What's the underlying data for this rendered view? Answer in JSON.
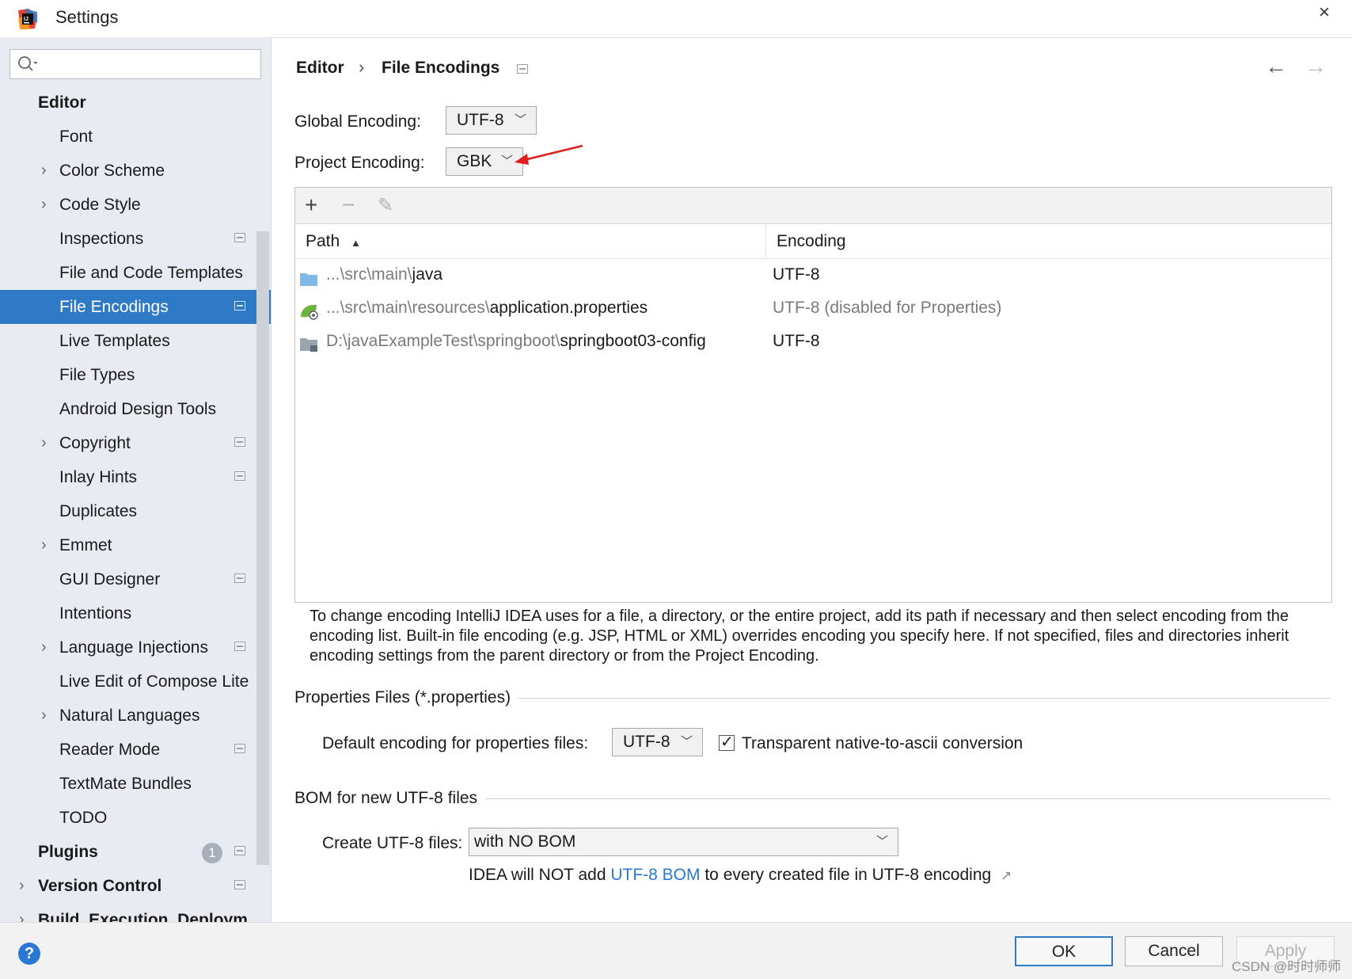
{
  "window": {
    "title": "Settings",
    "close_glyph": "×"
  },
  "search": {
    "placeholder": ""
  },
  "sidebar": {
    "items": [
      {
        "label": "Editor",
        "level": "top",
        "chevron": false,
        "proj": false
      },
      {
        "label": "Font",
        "level": "sub",
        "chevron": false,
        "proj": false
      },
      {
        "label": "Color Scheme",
        "level": "sub",
        "chevron": true,
        "proj": false
      },
      {
        "label": "Code Style",
        "level": "sub",
        "chevron": true,
        "proj": false
      },
      {
        "label": "Inspections",
        "level": "sub",
        "chevron": false,
        "proj": true
      },
      {
        "label": "File and Code Templates",
        "level": "sub",
        "chevron": false,
        "proj": false
      },
      {
        "label": "File Encodings",
        "level": "sub",
        "chevron": false,
        "proj": true,
        "selected": true
      },
      {
        "label": "Live Templates",
        "level": "sub",
        "chevron": false,
        "proj": false
      },
      {
        "label": "File Types",
        "level": "sub",
        "chevron": false,
        "proj": false
      },
      {
        "label": "Android Design Tools",
        "level": "sub",
        "chevron": false,
        "proj": false
      },
      {
        "label": "Copyright",
        "level": "sub",
        "chevron": true,
        "proj": true
      },
      {
        "label": "Inlay Hints",
        "level": "sub",
        "chevron": false,
        "proj": true
      },
      {
        "label": "Duplicates",
        "level": "sub",
        "chevron": false,
        "proj": false
      },
      {
        "label": "Emmet",
        "level": "sub",
        "chevron": true,
        "proj": false
      },
      {
        "label": "GUI Designer",
        "level": "sub",
        "chevron": false,
        "proj": true
      },
      {
        "label": "Intentions",
        "level": "sub",
        "chevron": false,
        "proj": false
      },
      {
        "label": "Language Injections",
        "level": "sub",
        "chevron": true,
        "proj": true
      },
      {
        "label": "Live Edit of Compose Lite",
        "level": "sub",
        "chevron": false,
        "proj": false
      },
      {
        "label": "Natural Languages",
        "level": "sub",
        "chevron": true,
        "proj": false
      },
      {
        "label": "Reader Mode",
        "level": "sub",
        "chevron": false,
        "proj": true
      },
      {
        "label": "TextMate Bundles",
        "level": "sub",
        "chevron": false,
        "proj": false
      },
      {
        "label": "TODO",
        "level": "sub",
        "chevron": false,
        "proj": false
      },
      {
        "label": "Plugins",
        "level": "top",
        "chevron": false,
        "proj": true,
        "badge": "1"
      },
      {
        "label": "Version Control",
        "level": "top",
        "chevron": true,
        "proj": true
      },
      {
        "label": "Build, Execution, Deploym",
        "level": "top",
        "chevron": true,
        "proj": false
      }
    ]
  },
  "breadcrumb": {
    "parent": "Editor",
    "separator": "›",
    "current": "File Encodings"
  },
  "nav": {
    "back": "←",
    "forward": "→"
  },
  "global_encoding": {
    "label": "Global Encoding:",
    "value": "UTF-8"
  },
  "project_encoding": {
    "label": "Project Encoding:",
    "value": "GBK"
  },
  "table": {
    "toolbar": {
      "add": "+",
      "remove": "−",
      "edit": "✎"
    },
    "columns": {
      "path": "Path",
      "sort_indicator": "▲",
      "encoding": "Encoding"
    },
    "rows": [
      {
        "path_prefix": "...\\src\\main\\",
        "path_name": "java",
        "encoding": "UTF-8",
        "encoding_muted": false,
        "icon": "folder-icon"
      },
      {
        "path_prefix": "...\\src\\main\\resources\\",
        "path_name": "application.properties",
        "encoding": "UTF-8 (disabled for Properties)",
        "encoding_muted": true,
        "icon": "spring-properties-icon"
      },
      {
        "path_prefix": "D:\\javaExampleTest\\springboot\\",
        "path_name": "springboot03-config",
        "encoding": "UTF-8",
        "encoding_muted": false,
        "icon": "module-folder-icon"
      }
    ]
  },
  "help_text": "To change encoding IntelliJ IDEA uses for a file, a directory, or the entire project, add its path if necessary and then select encoding from the encoding list. Built-in file encoding (e.g. JSP, HTML or XML) overrides encoding you specify here. If not specified, files and directories inherit encoding settings from the parent directory or from the Project Encoding.",
  "properties": {
    "section_title": "Properties Files (*.properties)",
    "default_label": "Default encoding for properties files:",
    "default_value": "UTF-8",
    "transparent_label": "Transparent native-to-ascii conversion",
    "transparent_checked": true
  },
  "bom": {
    "section_title": "BOM for new UTF-8 files",
    "create_label": "Create UTF-8 files:",
    "create_value": "with NO BOM",
    "note_prefix": "IDEA will NOT add ",
    "note_link": "UTF-8 BOM",
    "note_suffix": " to every created file in UTF-8 encoding",
    "note_arrow": "↗"
  },
  "buttons": {
    "ok": "OK",
    "cancel": "Cancel",
    "apply": "Apply"
  },
  "help_button": "?",
  "watermark": "CSDN @时时师师",
  "colors": {
    "accent": "#2f7ac6",
    "link": "#2a78d4",
    "sidebar_bg": "#e8ecf2",
    "annotation_arrow": "#e02020"
  }
}
